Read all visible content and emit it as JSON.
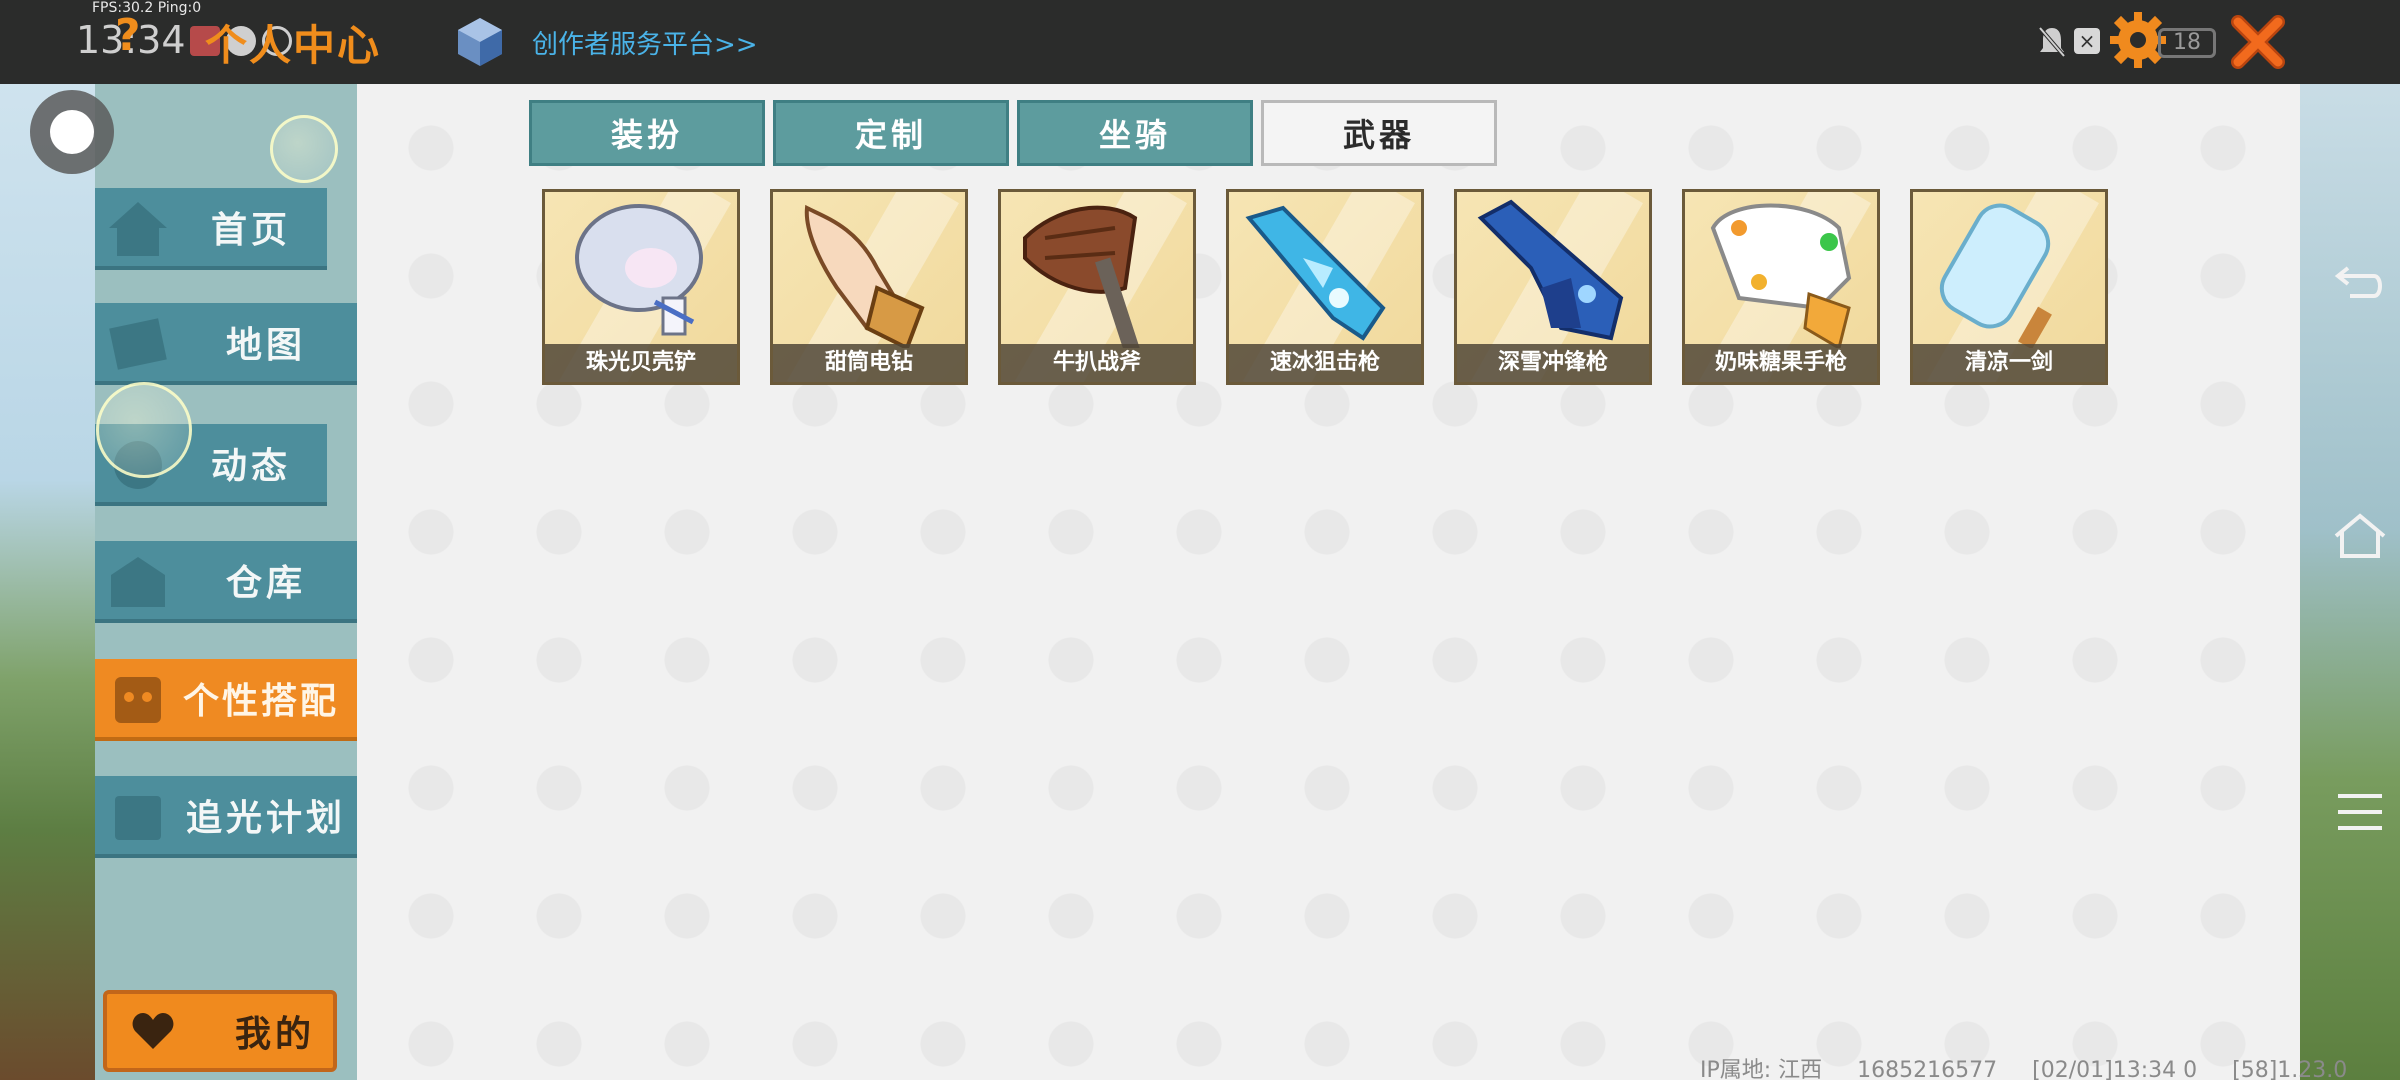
{
  "status_bar": {
    "fps": "FPS:30.2  Ping:0",
    "time": "13:34",
    "battery": "18"
  },
  "header": {
    "title": "个人中心",
    "creator_link": "创作者服务平台>>"
  },
  "sidebar": {
    "items": [
      {
        "label": "首页",
        "icon": "home-icon"
      },
      {
        "label": "地图",
        "icon": "map-icon"
      },
      {
        "label": "动态",
        "icon": "feed-icon"
      },
      {
        "label": "仓库",
        "icon": "warehouse-icon"
      },
      {
        "label": "个性搭配",
        "icon": "outfit-icon",
        "active": true
      },
      {
        "label": "追光计划",
        "icon": "plan-icon"
      }
    ],
    "mine_label": "我的"
  },
  "tabs": [
    {
      "label": "装扮"
    },
    {
      "label": "定制"
    },
    {
      "label": "坐骑"
    },
    {
      "label": "武器",
      "active": true
    }
  ],
  "items": [
    {
      "label": "珠光贝壳铲",
      "icon": "shell-shovel-icon"
    },
    {
      "label": "甜筒电钻",
      "icon": "icecream-drill-icon"
    },
    {
      "label": "牛扒战斧",
      "icon": "steak-axe-icon"
    },
    {
      "label": "速冰狙击枪",
      "icon": "ice-sniper-icon"
    },
    {
      "label": "深雪冲锋枪",
      "icon": "snow-smg-icon"
    },
    {
      "label": "奶味糖果手枪",
      "icon": "candy-pistol-icon"
    },
    {
      "label": "清凉一剑",
      "icon": "popsicle-sword-icon"
    }
  ],
  "footer": {
    "ip_location": "IP属地: 江西",
    "uid": "1685216577",
    "timestamp": "[02/01]13:34 0",
    "version": "[58]1.23.0"
  },
  "colors": {
    "accent_orange": "#f08a1e",
    "tab_teal": "#5d9c9e",
    "nav_teal": "#4d8e9c",
    "link_blue": "#4ab3e8"
  }
}
